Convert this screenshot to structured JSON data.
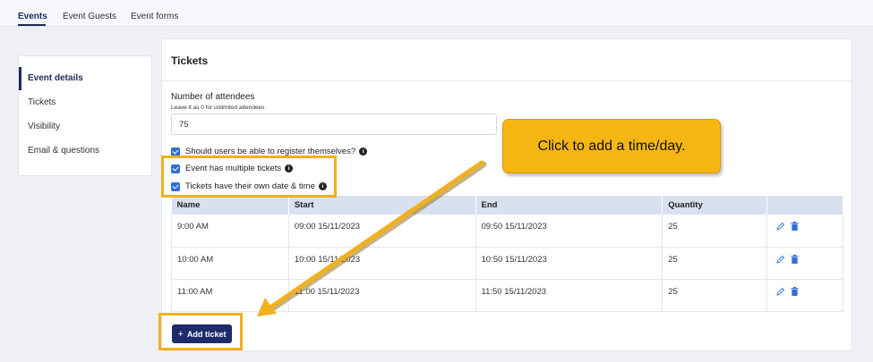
{
  "tabs": [
    {
      "label": "Events",
      "active": true
    },
    {
      "label": "Event Guests",
      "active": false
    },
    {
      "label": "Event forms",
      "active": false
    }
  ],
  "sidebar": {
    "items": [
      {
        "label": "Event details",
        "active": true
      },
      {
        "label": "Tickets",
        "active": false
      },
      {
        "label": "Visibility",
        "active": false
      },
      {
        "label": "Email & questions",
        "active": false
      }
    ]
  },
  "card": {
    "title": "Tickets",
    "attendees": {
      "label": "Number of attendees",
      "hint": "Leave it as 0 for unlimited attendees",
      "value": "75"
    },
    "checkboxes": [
      {
        "label": "Should users be able to register themselves?",
        "checked": true
      },
      {
        "label": "Event has multiple tickets",
        "checked": true
      },
      {
        "label": "Tickets have their own date & time",
        "checked": true
      }
    ],
    "table": {
      "headers": [
        "Name",
        "Start",
        "End",
        "Quantity",
        ""
      ],
      "rows": [
        {
          "name": "9:00 AM",
          "start": "09:00 15/11/2023",
          "end": "09:50 15/11/2023",
          "quantity": "25"
        },
        {
          "name": "10:00 AM",
          "start": "10:00 15/11/2023",
          "end": "10:50 15/11/2023",
          "quantity": "25"
        },
        {
          "name": "11:00 AM",
          "start": "11:00 15/11/2023",
          "end": "11:50 15/11/2023",
          "quantity": "25"
        }
      ]
    },
    "add_button": {
      "icon": "plus-icon",
      "label": "Add ticket"
    }
  },
  "annotation": {
    "callout_text": "Click to add a time/day.",
    "color": "#f5b614"
  },
  "colors": {
    "primary": "#1d2a6b",
    "checkbox": "#2f6fdb",
    "table_header": "#d9e0ef",
    "highlight": "#f2b01e",
    "action_icon": "#2f6fdb"
  }
}
